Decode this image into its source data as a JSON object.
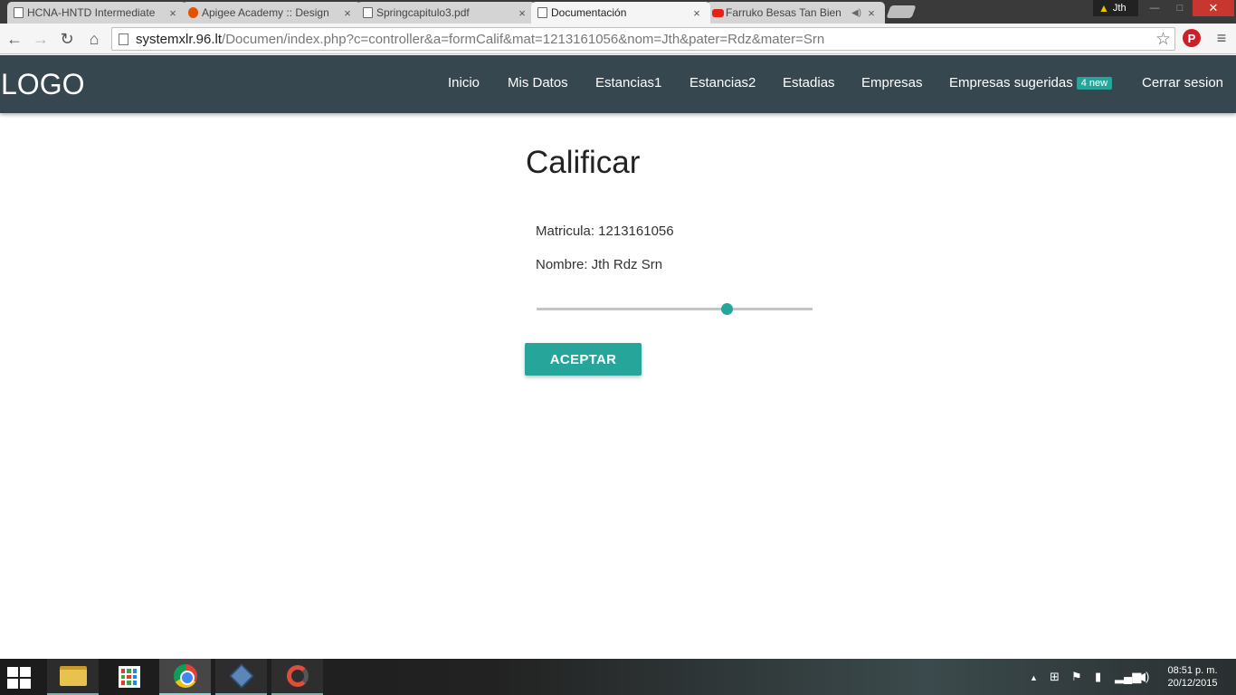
{
  "browser": {
    "tabs": [
      {
        "title": "HCNA-HNTD Intermediate",
        "icon": "page-icon"
      },
      {
        "title": "Apigee Academy :: Design",
        "icon": "apigee-icon"
      },
      {
        "title": "Springcapitulo3.pdf",
        "icon": "page-icon"
      },
      {
        "title": "Documentación",
        "icon": "page-icon",
        "active": true
      },
      {
        "title": "Farruko Besas Tan Bien",
        "icon": "youtube-icon"
      }
    ],
    "tab_close": "×",
    "audio_symbol": "◀)",
    "profile_name": "Jth",
    "window_controls": {
      "minimize": "—",
      "maximize": "□",
      "close": "✕"
    },
    "url_host": "systemxlr.96.lt",
    "url_path": "/Documen/index.php?c=controller&a=formCalif&mat=1213161056&nom=Jth&pater=Rdz&mater=Srn"
  },
  "nav": {
    "logo": "LOGO",
    "links": [
      "Inicio",
      "Mis Datos",
      "Estancias1",
      "Estancias2",
      "Estadias",
      "Empresas",
      "Empresas sugeridas",
      "Cerrar sesion"
    ],
    "badge": "4 new"
  },
  "main": {
    "title": "Calificar",
    "matricula": "Matricula: 1213161056",
    "nombre": "Nombre: Jth Rdz Srn",
    "slider_value": 0.69,
    "button": "ACEPTAR"
  },
  "taskbar": {
    "apps": [
      "file-explorer-icon",
      "store-icon",
      "chrome-icon",
      "virtualbox-icon",
      "app-icon"
    ],
    "time": "08:51 p. m.",
    "date": "20/12/2015"
  },
  "colors": {
    "nav_bg": "#37474f",
    "accent": "#26a69a"
  }
}
